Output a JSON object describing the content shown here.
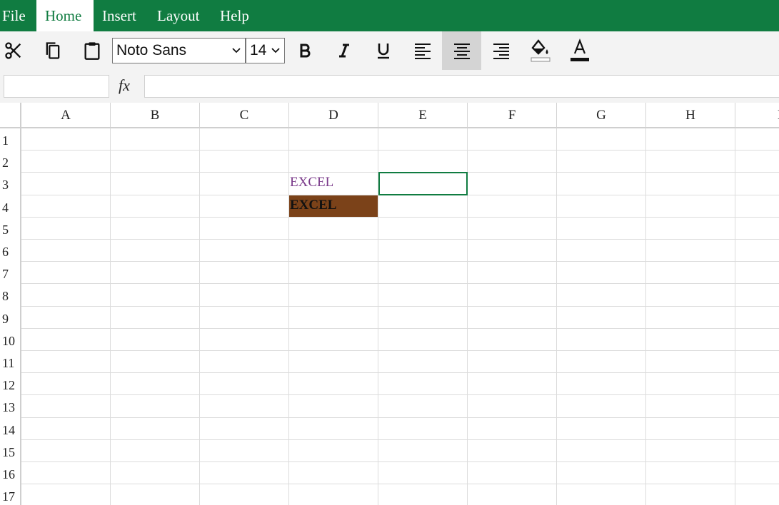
{
  "menu": {
    "file": "File",
    "home": "Home",
    "insert": "Insert",
    "layout": "Layout",
    "help": "Help"
  },
  "toolbar": {
    "font_family": "Noto Sans",
    "font_size": "14",
    "icons": [
      "scissors-icon",
      "copy-icon",
      "paste-icon",
      "bold-icon",
      "italic-icon",
      "underline-icon",
      "align-left-icon",
      "align-center-icon",
      "align-right-icon",
      "fill-color-icon",
      "font-color-icon"
    ],
    "active_alignment": "center"
  },
  "formula_bar": {
    "name_box": "",
    "fx_label": "fx",
    "formula": ""
  },
  "grid": {
    "columns": [
      "A",
      "B",
      "C",
      "D",
      "E",
      "F",
      "G",
      "H",
      "I"
    ],
    "rows": [
      "1",
      "2",
      "3",
      "4",
      "5",
      "6",
      "7",
      "8",
      "9",
      "10",
      "11",
      "12",
      "13",
      "14",
      "15",
      "16",
      "17"
    ],
    "cells": {
      "D3": "EXCEL",
      "D4": "EXCEL"
    },
    "selected_cell": "E3"
  },
  "colors": {
    "brand": "#107c41",
    "d3_text": "#7a3a8a",
    "d4_fill": "#7b4219"
  }
}
